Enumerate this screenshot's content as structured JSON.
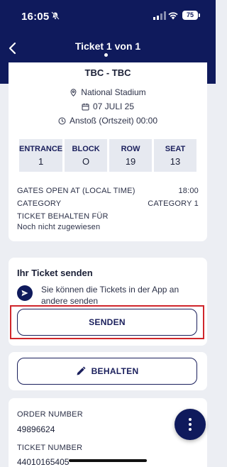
{
  "status_bar": {
    "time": "16:05",
    "battery": "75"
  },
  "header": {
    "title": "Ticket 1 von 1"
  },
  "ticket": {
    "match": "TBC - TBC",
    "venue": "National Stadium",
    "date": "07 JULI 25",
    "kickoff": "Anstoß (Ortszeit) 00:00",
    "seat_boxes": [
      {
        "label": "ENTRANCE",
        "value": "1"
      },
      {
        "label": "BLOCK",
        "value": "O"
      },
      {
        "label": "ROW",
        "value": "19"
      },
      {
        "label": "SEAT",
        "value": "13"
      }
    ],
    "details": [
      {
        "label": "GATES OPEN AT (LOCAL TIME)",
        "value": "18:00"
      },
      {
        "label": "CATEGORY",
        "value": "CATEGORY 1"
      }
    ],
    "holder_label": "TICKET BEHALTEN FÜR",
    "holder_value": "Noch nicht zugewiesen"
  },
  "send_section": {
    "title": "Ihr Ticket senden",
    "description": "Sie können die Tickets in der App an andere senden",
    "button_label": "SENDEN"
  },
  "keep_section": {
    "button_label": "BEHALTEN"
  },
  "order": {
    "order_number_label": "ORDER NUMBER",
    "order_number": "49896624",
    "ticket_number_label": "TICKET NUMBER",
    "ticket_number": "44010165405"
  },
  "colors": {
    "primary": "#0f1a5c",
    "highlight": "#d0262b",
    "background": "#eceef3"
  }
}
